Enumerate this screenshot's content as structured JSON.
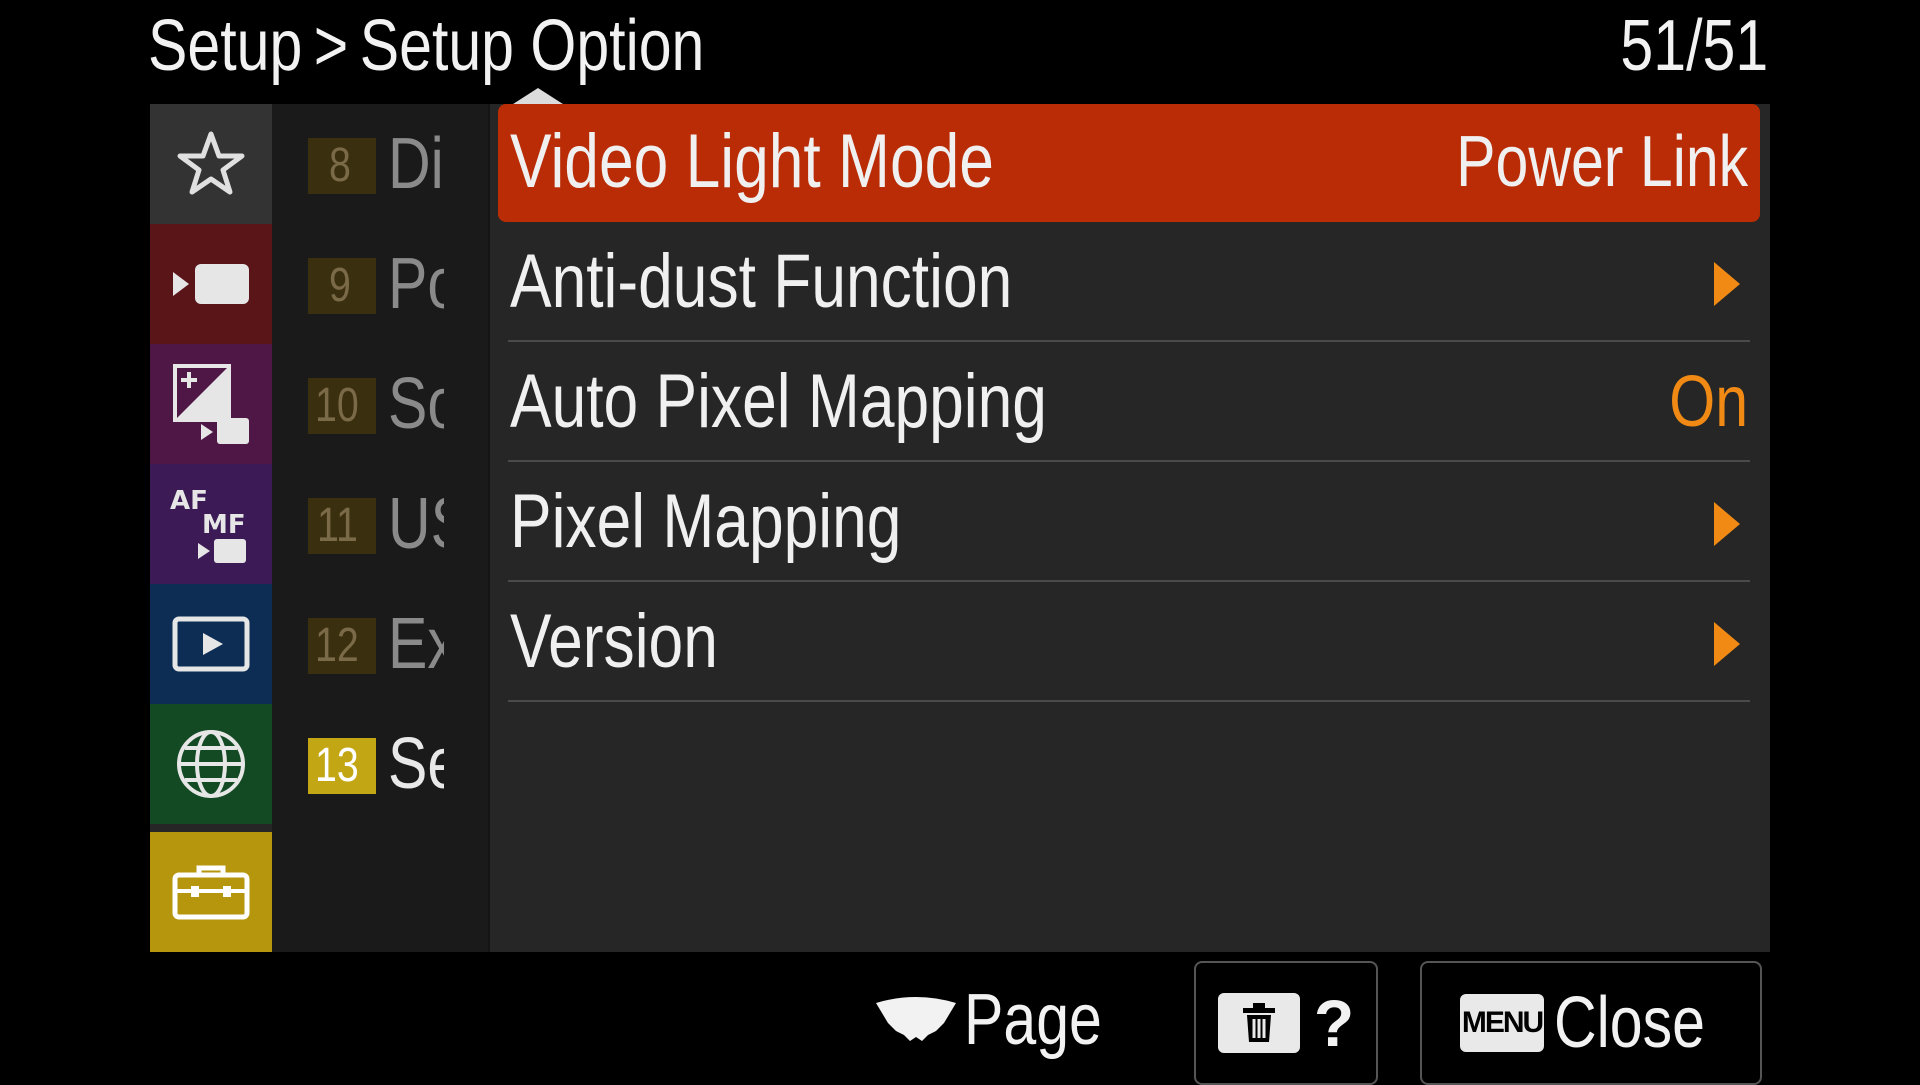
{
  "header": {
    "crumb_parent": "Setup",
    "crumb_separator": ">",
    "crumb_current": "Setup Option",
    "page_counter": "51/51"
  },
  "tabs": [
    {
      "icon": "star-icon",
      "color": "#333333",
      "selected": false
    },
    {
      "icon": "movie-camera-icon",
      "color": "#5a1519",
      "selected": false
    },
    {
      "icon": "exposure-movie-icon",
      "color": "#4f1746",
      "selected": false
    },
    {
      "icon": "af-mf-movie-icon",
      "color": "#3b1a55",
      "selected": false
    },
    {
      "icon": "playback-icon",
      "color": "#0e2d55",
      "selected": false
    },
    {
      "icon": "network-globe-icon",
      "color": "#134a24",
      "selected": false
    },
    {
      "icon": "toolbox-icon",
      "color": "#b5960c",
      "selected": true
    }
  ],
  "pages": [
    {
      "number": "8",
      "name": "Di",
      "active": false
    },
    {
      "number": "9",
      "name": "Po",
      "active": false
    },
    {
      "number": "10",
      "name": "So",
      "active": false
    },
    {
      "number": "11",
      "name": "US",
      "active": false
    },
    {
      "number": "12",
      "name": "Ex",
      "active": false
    },
    {
      "number": "13",
      "name": "Se",
      "active": true
    }
  ],
  "items": [
    {
      "label": "Video Light Mode",
      "value": "Power Link",
      "selected": true
    },
    {
      "label": "Anti-dust Function",
      "value": "",
      "arrow": true
    },
    {
      "label": "Auto Pixel Mapping",
      "value": "On",
      "value_color": "orange"
    },
    {
      "label": "Pixel Mapping",
      "value": "",
      "arrow": true
    },
    {
      "label": "Version",
      "value": "",
      "arrow": true
    }
  ],
  "footer": {
    "page_label": "Page",
    "help_label": "?",
    "menu_key": "MENU",
    "close_label": "Close"
  },
  "colors": {
    "accent": "#b92c05",
    "value_orange": "#f08a14",
    "active_page": "#c3a614"
  }
}
